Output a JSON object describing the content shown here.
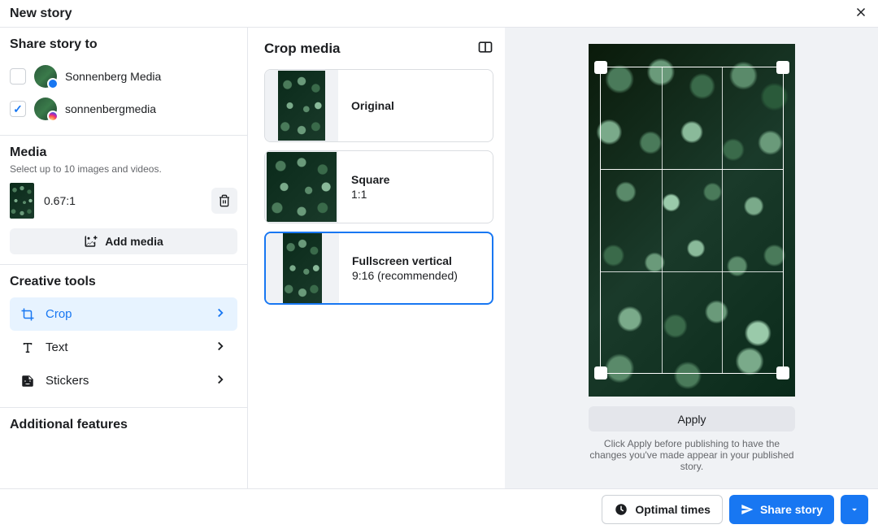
{
  "header": {
    "title": "New story"
  },
  "share": {
    "heading": "Share story to",
    "accounts": [
      {
        "name": "Sonnenberg Media",
        "platform": "fb",
        "checked": false
      },
      {
        "name": "sonnenbergmedia",
        "platform": "ig",
        "checked": true
      }
    ]
  },
  "media": {
    "heading": "Media",
    "hint": "Select up to 10 images and videos.",
    "items": [
      {
        "ratio": "0.67:1"
      }
    ],
    "add_label": "Add media"
  },
  "tools": {
    "heading": "Creative tools",
    "items": [
      {
        "key": "crop",
        "label": "Crop",
        "active": true
      },
      {
        "key": "text",
        "label": "Text",
        "active": false
      },
      {
        "key": "stickers",
        "label": "Stickers",
        "active": false
      }
    ]
  },
  "additional": {
    "heading": "Additional features"
  },
  "crop": {
    "heading": "Crop media",
    "options": [
      {
        "title": "Original",
        "sub": "",
        "selected": false,
        "shape": "original"
      },
      {
        "title": "Square",
        "sub": "1:1",
        "selected": false,
        "shape": "square"
      },
      {
        "title": "Fullscreen vertical",
        "sub": "9:16 (recommended)",
        "selected": true,
        "shape": "vertical"
      }
    ]
  },
  "preview": {
    "apply_label": "Apply",
    "note": "Click Apply before publishing to have the changes you've made appear in your published story."
  },
  "footer": {
    "optimal_label": "Optimal times",
    "share_label": "Share story"
  }
}
